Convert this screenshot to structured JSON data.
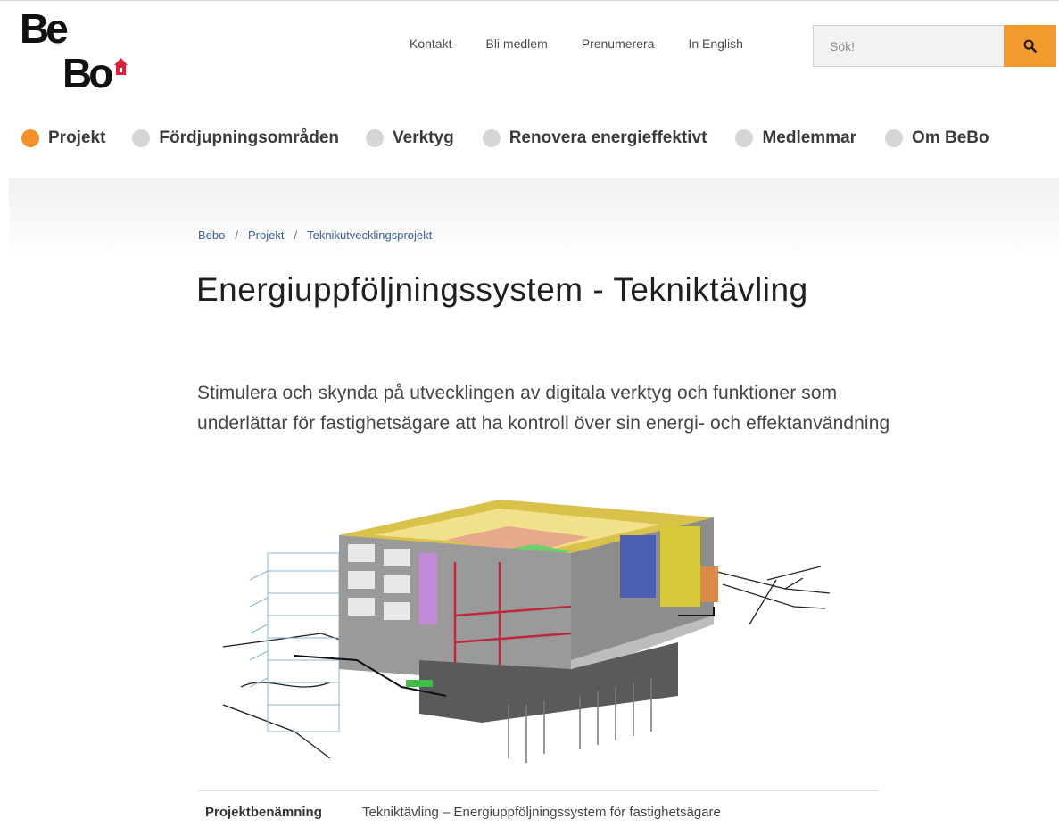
{
  "logo": {
    "text_line1": "Be",
    "text_line2": "Bo",
    "alt": "BeBo"
  },
  "utility_nav": [
    {
      "label": "Kontakt"
    },
    {
      "label": "Bli medlem"
    },
    {
      "label": "Prenumerera"
    },
    {
      "label": "In English"
    }
  ],
  "search": {
    "placeholder": "Sök!",
    "icon": "search-icon"
  },
  "colors": {
    "accent": "#f39a2e",
    "active_dot": "#f3922b",
    "inactive_dot": "#d6d6d6",
    "link": "#3a5fa0"
  },
  "main_nav": [
    {
      "label": "Projekt",
      "active": true
    },
    {
      "label": "Fördjupningsområden",
      "active": false
    },
    {
      "label": "Verktyg",
      "active": false
    },
    {
      "label": "Renovera energieffektivt",
      "active": false
    },
    {
      "label": "Medlemmar",
      "active": false
    },
    {
      "label": "Om BeBo",
      "active": false
    }
  ],
  "breadcrumb": [
    {
      "label": "Bebo"
    },
    {
      "label": "Projekt"
    },
    {
      "label": "Teknikutvecklingsprojekt"
    }
  ],
  "breadcrumb_separator": "/",
  "page": {
    "title": "Energiuppföljningssystem - Tekniktävling",
    "lead": "Stimulera och skynda på utvecklingen av digitala verktyg och funktioner som underlättar för fastighetsägare att ha kontroll över sin energi- och effektanvändning"
  },
  "project_info": {
    "label": "Projektbenämning",
    "value": "Tekniktävling – Energiuppföljningssystem för fastighetsägare"
  }
}
